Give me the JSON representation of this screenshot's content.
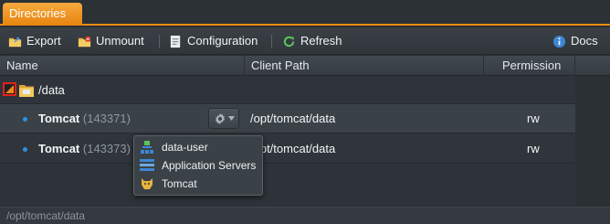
{
  "tabs": [
    {
      "label": "Directories"
    }
  ],
  "toolbar": {
    "export": "Export",
    "unmount": "Unmount",
    "configuration": "Configuration",
    "refresh": "Refresh",
    "docs": "Docs"
  },
  "columns": {
    "name": "Name",
    "client_path": "Client Path",
    "permission": "Permission"
  },
  "group": {
    "label": "/data"
  },
  "rows": [
    {
      "name": "Tomcat",
      "id": "(143371)",
      "client_path": "/opt/tomcat/data",
      "permission": "rw"
    },
    {
      "name": "Tomcat",
      "id": "(143373)",
      "client_path": "/opt/tomcat/data",
      "permission": "rw"
    }
  ],
  "popup": {
    "items": [
      {
        "label": "data-user",
        "icon": "user-node-icon"
      },
      {
        "label": "Application Servers",
        "icon": "server-stack-icon"
      },
      {
        "label": "Tomcat",
        "icon": "tomcat-icon"
      }
    ]
  },
  "status": {
    "path": "/opt/tomcat/data"
  },
  "colors": {
    "accent": "#f08a14",
    "bullet": "#2f8fe6",
    "highlight": "#e0231b"
  }
}
